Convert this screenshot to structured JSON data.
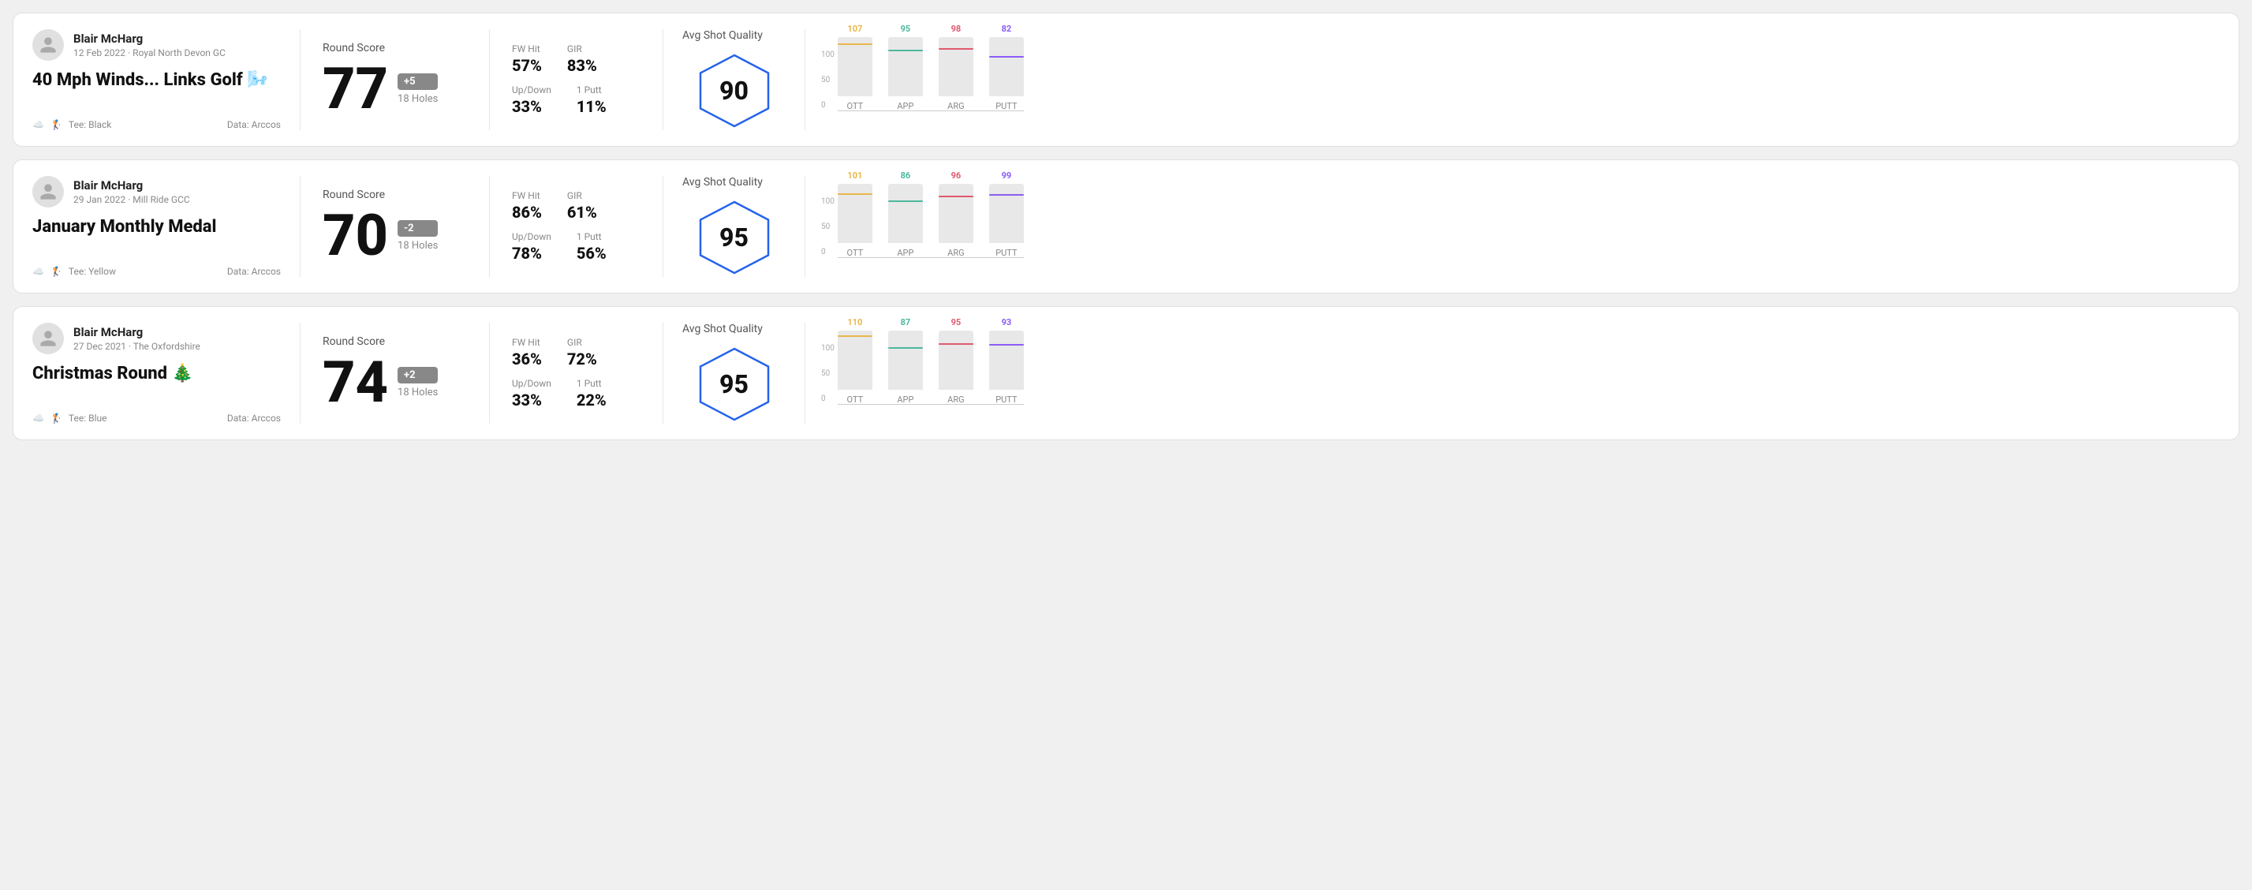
{
  "rounds": [
    {
      "id": "round-1",
      "user": {
        "name": "Blair McHarg",
        "date": "12 Feb 2022 · Royal North Devon GC"
      },
      "title": "40 Mph Winds... Links Golf 🌬️",
      "tee": "Black",
      "data_source": "Data: Arccos",
      "score": "77",
      "score_diff": "+5",
      "score_diff_sign": "positive",
      "holes": "18 Holes",
      "fw_hit": "57%",
      "gir": "83%",
      "up_down": "33%",
      "one_putt": "11%",
      "avg_shot_quality": "90",
      "chart": {
        "bars": [
          {
            "label": "OTT",
            "value": 107,
            "color": "#e8b84b",
            "max": 120
          },
          {
            "label": "APP",
            "value": 95,
            "color": "#4db89e",
            "max": 120
          },
          {
            "label": "ARG",
            "value": 98,
            "color": "#e05a6e",
            "max": 120
          },
          {
            "label": "PUTT",
            "value": 82,
            "color": "#8b5cf6",
            "max": 120
          }
        ]
      }
    },
    {
      "id": "round-2",
      "user": {
        "name": "Blair McHarg",
        "date": "29 Jan 2022 · Mill Ride GCC"
      },
      "title": "January Monthly Medal",
      "tee": "Yellow",
      "data_source": "Data: Arccos",
      "score": "70",
      "score_diff": "-2",
      "score_diff_sign": "negative",
      "holes": "18 Holes",
      "fw_hit": "86%",
      "gir": "61%",
      "up_down": "78%",
      "one_putt": "56%",
      "avg_shot_quality": "95",
      "chart": {
        "bars": [
          {
            "label": "OTT",
            "value": 101,
            "color": "#e8b84b",
            "max": 120
          },
          {
            "label": "APP",
            "value": 86,
            "color": "#4db89e",
            "max": 120
          },
          {
            "label": "ARG",
            "value": 96,
            "color": "#e05a6e",
            "max": 120
          },
          {
            "label": "PUTT",
            "value": 99,
            "color": "#8b5cf6",
            "max": 120
          }
        ]
      }
    },
    {
      "id": "round-3",
      "user": {
        "name": "Blair McHarg",
        "date": "27 Dec 2021 · The Oxfordshire"
      },
      "title": "Christmas Round 🎄",
      "tee": "Blue",
      "data_source": "Data: Arccos",
      "score": "74",
      "score_diff": "+2",
      "score_diff_sign": "positive",
      "holes": "18 Holes",
      "fw_hit": "36%",
      "gir": "72%",
      "up_down": "33%",
      "one_putt": "22%",
      "avg_shot_quality": "95",
      "chart": {
        "bars": [
          {
            "label": "OTT",
            "value": 110,
            "color": "#e8b84b",
            "max": 120
          },
          {
            "label": "APP",
            "value": 87,
            "color": "#4db89e",
            "max": 120
          },
          {
            "label": "ARG",
            "value": 95,
            "color": "#e05a6e",
            "max": 120
          },
          {
            "label": "PUTT",
            "value": 93,
            "color": "#8b5cf6",
            "max": 120
          }
        ]
      }
    }
  ],
  "labels": {
    "round_score": "Round Score",
    "fw_hit": "FW Hit",
    "gir": "GIR",
    "up_down": "Up/Down",
    "one_putt": "1 Putt",
    "avg_shot_quality": "Avg Shot Quality",
    "tee_prefix": "Tee:",
    "axis_100": "100",
    "axis_50": "50",
    "axis_0": "0"
  }
}
